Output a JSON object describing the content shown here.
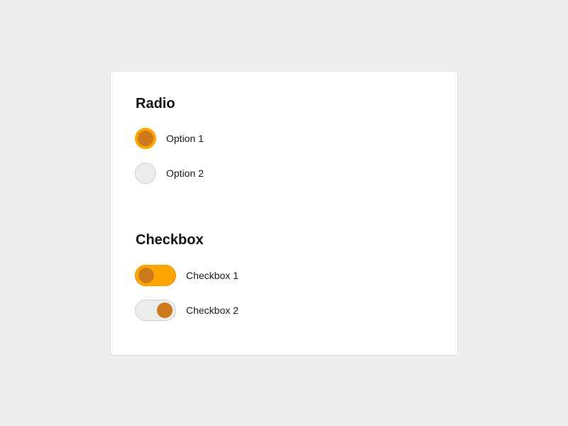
{
  "colors": {
    "background": "#eeeeee",
    "card": "#ffffff",
    "accent": "#ffa500",
    "knob": "#cc7a1c",
    "unchecked": "#ececec"
  },
  "radio": {
    "title": "Radio",
    "options": [
      {
        "label": "Option 1",
        "checked": true
      },
      {
        "label": "Option 2",
        "checked": false
      }
    ]
  },
  "checkbox": {
    "title": "Checkbox",
    "items": [
      {
        "label": "Checkbox 1",
        "checked": true
      },
      {
        "label": "Checkbox 2",
        "checked": false
      }
    ]
  }
}
